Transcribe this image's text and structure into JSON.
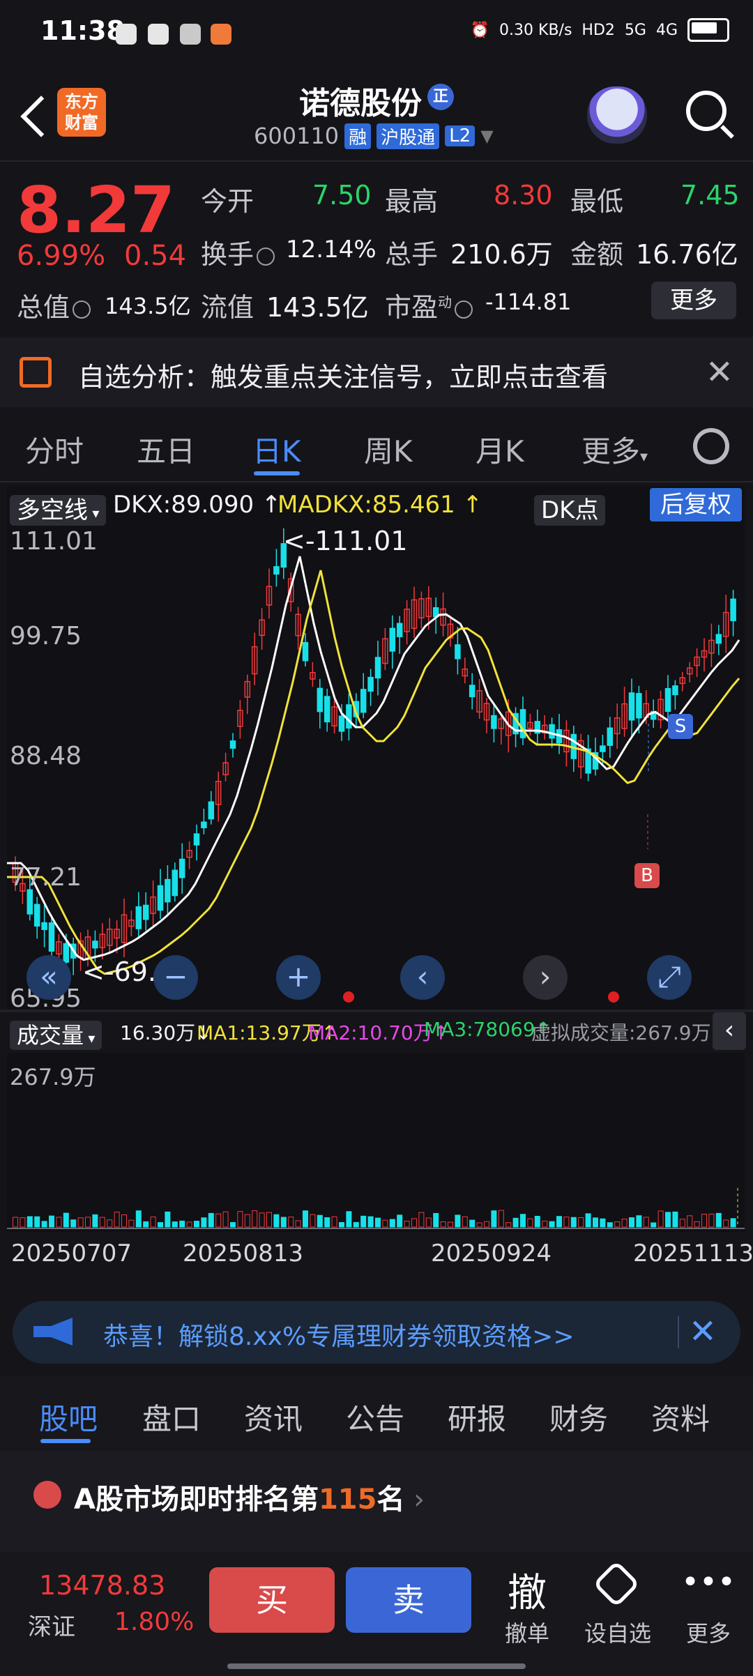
{
  "status_bar": {
    "time": "11:38",
    "net_speed": "0.30 KB/s",
    "signal1": "5G",
    "signal2": "4G",
    "hd": "HD2"
  },
  "header": {
    "logo_text": "东方财富",
    "title": "诺德股份",
    "badge": "正",
    "code": "600110",
    "tags": [
      "融",
      "沪股通",
      "L2"
    ]
  },
  "quote": {
    "price": "8.27",
    "change_pct": "6.99%",
    "change_amt": "0.54",
    "open_label": "今开",
    "open": "7.50",
    "high_label": "最高",
    "high": "8.30",
    "low_label": "最低",
    "low": "7.45",
    "turnover_label": "换手",
    "turnover": "12.14%",
    "volume_label": "总手",
    "volume": "210.6万",
    "amount_label": "金额",
    "amount": "16.76亿",
    "mktcap_label": "总值",
    "mktcap": "143.5亿",
    "float_label": "流值",
    "float_cap": "143.5亿",
    "pe_label": "市盈",
    "pe_sup": "动",
    "pe": "-114.81",
    "more_label": "更多"
  },
  "notice": {
    "text": "自选分析：触发重点关注信号，立即点击查看"
  },
  "chart_tabs": [
    {
      "label": "分时",
      "active": false
    },
    {
      "label": "五日",
      "active": false
    },
    {
      "label": "日K",
      "active": true
    },
    {
      "label": "周K",
      "active": false
    },
    {
      "label": "月K",
      "active": false
    },
    {
      "label": "更多",
      "active": false
    }
  ],
  "indicator": {
    "name": "多空线",
    "dkx": "DKX:89.090",
    "madkx": "MADKX:85.461",
    "dk_point": "DK点",
    "adjust": "后复权"
  },
  "price_axis": [
    "111.01",
    "99.75",
    "88.48",
    "77.21",
    "65.95"
  ],
  "annotations": {
    "max": "<-111.01",
    "min": "<-69.91",
    "sell_marker": "S",
    "buy_marker": "B"
  },
  "volume": {
    "name": "成交量",
    "value": "16.30万",
    "ma1": "MA1:13.97万",
    "ma2": "MA2:10.70万",
    "ma3": "MA3:78069",
    "virtual": "虚拟成交量:267.9万",
    "axis_max": "267.9万"
  },
  "x_dates": [
    "20250707",
    "20250813",
    "20250924",
    "20251113"
  ],
  "colors": {
    "up": "#f23a3a",
    "down": "#18e0e8",
    "ma_white": "#ffffff",
    "ma_yellow": "#f2e23a",
    "accent": "#4a8cff"
  },
  "chart_data": {
    "type": "line",
    "title": "",
    "x": [],
    "ylim": [
      65.95,
      111.01
    ],
    "series": []
  },
  "banner": {
    "text": "恭喜！解锁8.xx%专属理财券领取资格>>"
  },
  "bottom_tabs": [
    "股吧",
    "盘口",
    "资讯",
    "公告",
    "研报",
    "财务",
    "资料"
  ],
  "rank": {
    "prefix": "A股市场即时排名第",
    "number": "115",
    "suffix": "名"
  },
  "index": {
    "value": "13478.83",
    "name": "深证",
    "pct": "1.80%"
  },
  "actions": {
    "buy": "买",
    "sell": "卖",
    "cancel_icon": "撤",
    "cancel": "撤单",
    "set_watch": "设自选",
    "more": "更多"
  }
}
